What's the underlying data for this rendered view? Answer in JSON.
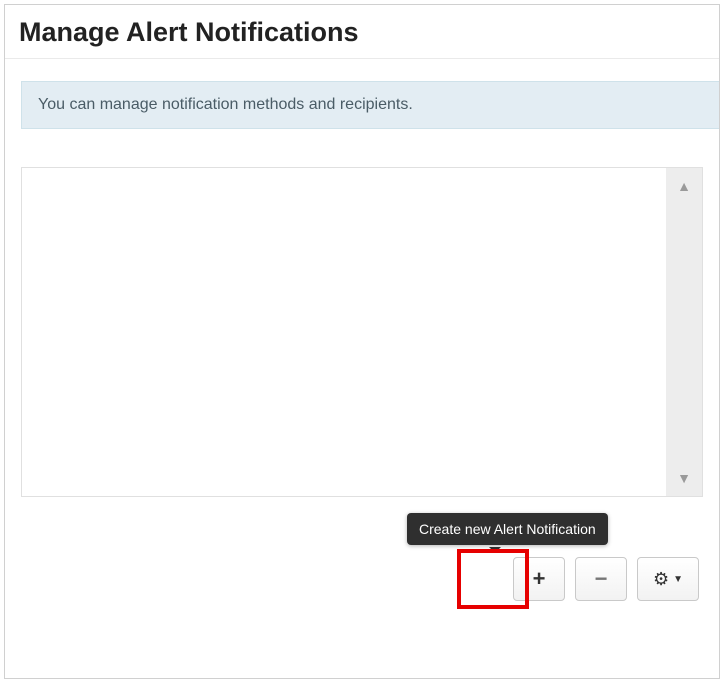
{
  "header": {
    "title": "Manage Alert Notifications"
  },
  "info": {
    "text": "You can manage notification methods and recipients."
  },
  "tooltip": {
    "text": "Create new Alert Notification"
  },
  "toolbar": {
    "add_label": "+",
    "remove_label": "−",
    "gear_label": "⚙",
    "caret_label": "▼"
  },
  "scroll": {
    "up_label": "▲",
    "down_label": "▼"
  }
}
